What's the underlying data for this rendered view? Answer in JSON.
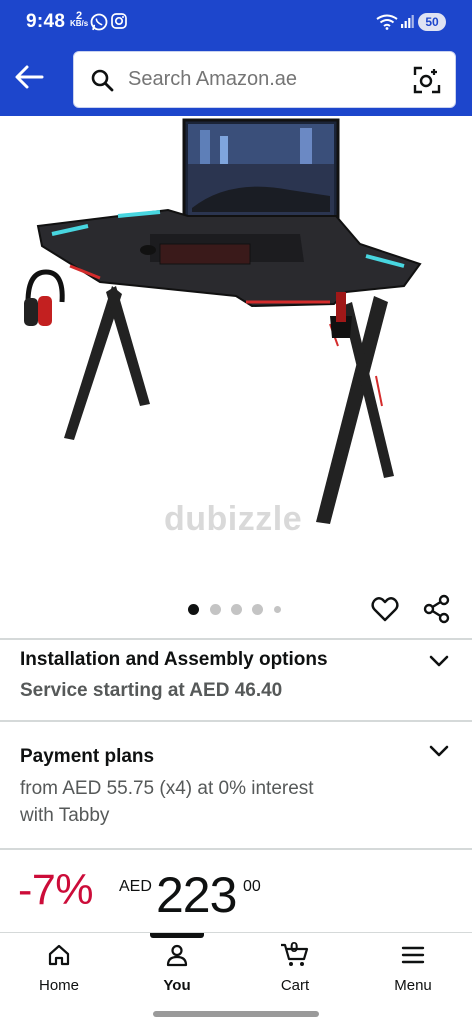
{
  "status_bar": {
    "time": "9:48",
    "net_speed_value": "2",
    "net_speed_unit": "KB/s",
    "battery": "50"
  },
  "header": {
    "search_placeholder": "Search Amazon.ae",
    "back_icon": "arrow-left-icon",
    "search_icon": "magnifier-icon",
    "lens_icon": "camera-lens-icon",
    "brand_color": "#1d46cc"
  },
  "product_image": {
    "watermark": "dubizzle",
    "carousel": {
      "count": 5,
      "active_index": 0
    }
  },
  "actions": {
    "wishlist_icon": "heart-icon",
    "share_icon": "share-icon"
  },
  "installation": {
    "title": "Installation and Assembly options",
    "subtitle": "Service starting at AED 46.40"
  },
  "payment": {
    "title": "Payment plans",
    "line1": "from AED 55.75 (x4) at 0% interest",
    "line2": "with Tabby"
  },
  "price": {
    "discount": "-7%",
    "currency": "AED",
    "whole": "223",
    "fraction": "00",
    "discount_color": "#cc0c39"
  },
  "bottom_nav": {
    "items": [
      {
        "label": "Home",
        "icon": "home-icon"
      },
      {
        "label": "You",
        "icon": "person-icon"
      },
      {
        "label": "Cart",
        "icon": "cart-icon",
        "badge": "0"
      },
      {
        "label": "Menu",
        "icon": "hamburger-menu-icon"
      }
    ],
    "active_index": 1
  }
}
